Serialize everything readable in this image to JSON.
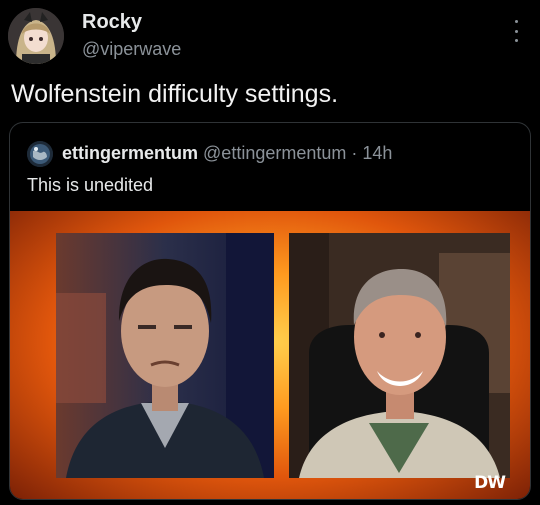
{
  "author": {
    "name": "Rocky",
    "handle": "@viperwave",
    "avatar_icon": "anime-girl-avatar"
  },
  "tweet": {
    "text": "Wolfenstein difficulty settings."
  },
  "more_icon": "more-vertical-icon",
  "quote": {
    "name": "ettingermentum",
    "handle": "@ettingermentum",
    "separator": "·",
    "time": "14h",
    "text": "This is unedited",
    "avatar_icon": "globe-avatar"
  },
  "media": {
    "watermark": "DW",
    "background_colors": [
      "#ffcf4d",
      "#ff9a1f",
      "#e0560c",
      "#7a2006"
    ]
  },
  "colors": {
    "background": "#000000",
    "text": "#e7e9ea",
    "muted": "#8b9299",
    "border": "#2f3336"
  }
}
